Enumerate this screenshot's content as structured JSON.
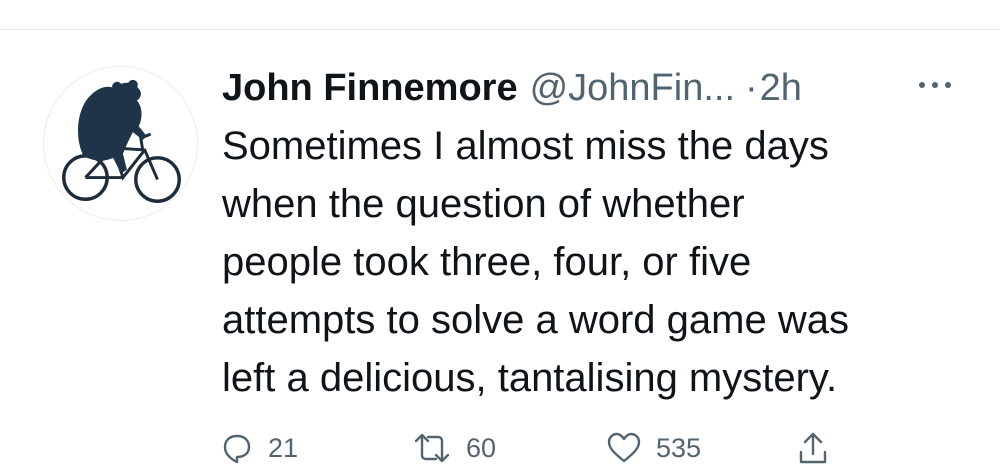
{
  "tweet": {
    "author": {
      "display_name": "John Finnemore",
      "handle": "@JohnFin...",
      "avatar_icon": "bear-on-bicycle-icon"
    },
    "separator": "·",
    "time": "2h",
    "more_icon": "ellipsis-icon",
    "text_lines": [
      "Sometimes I almost miss the days",
      "when the question of whether",
      "people took three, four, or five",
      "attempts to solve a word game was",
      "left a delicious, tantalising mystery."
    ],
    "actions": {
      "reply": {
        "icon": "reply-icon",
        "count": "21"
      },
      "retweet": {
        "icon": "retweet-icon",
        "count": "60"
      },
      "like": {
        "icon": "heart-icon",
        "count": "535"
      },
      "share": {
        "icon": "share-icon"
      }
    }
  },
  "colors": {
    "text_primary": "#0f1419",
    "text_secondary": "#536471",
    "background": "#ffffff",
    "divider": "#e6e9eb"
  }
}
